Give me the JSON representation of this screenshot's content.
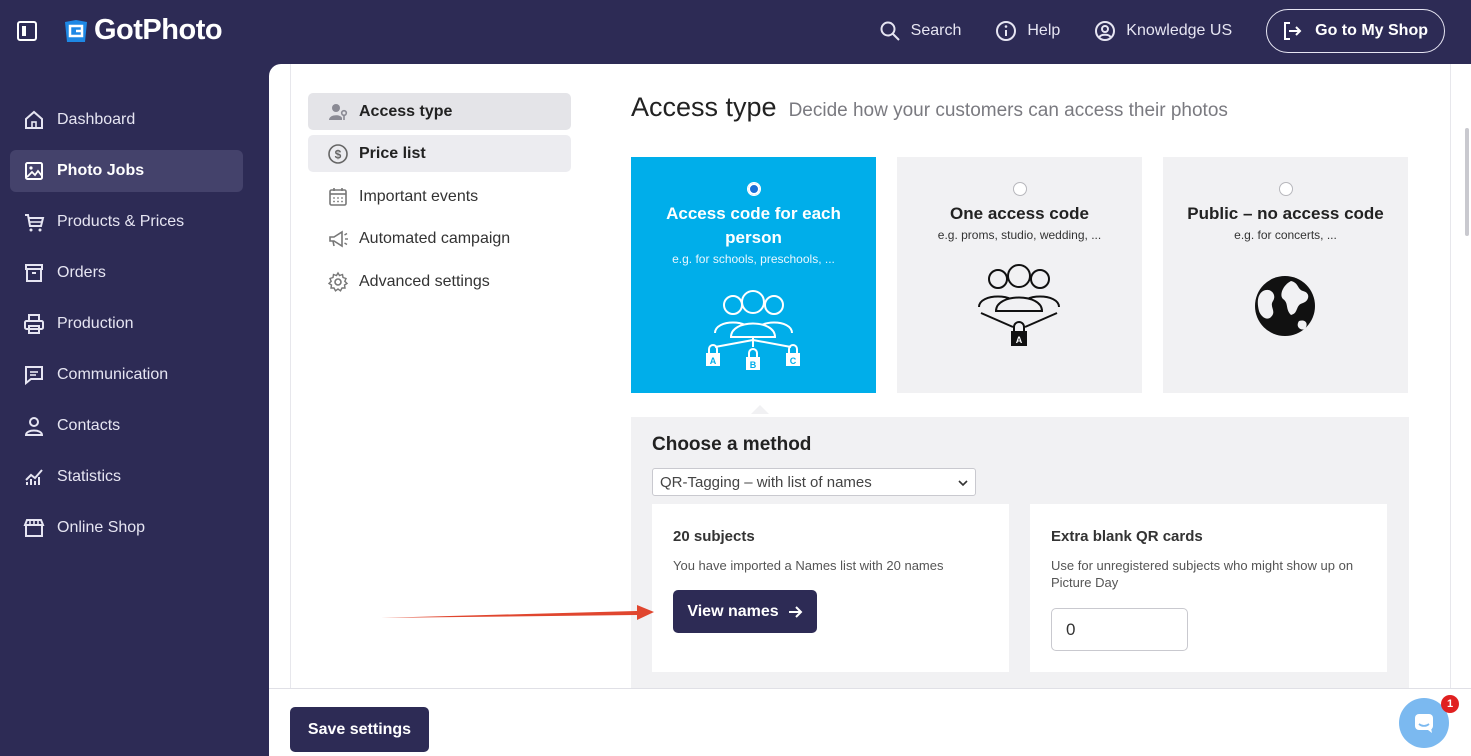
{
  "app": {
    "brand": "GotPhoto"
  },
  "topbar": {
    "search_label": "Search",
    "help_label": "Help",
    "account_label": "Knowledge US",
    "shop_button_label": "Go to My Shop"
  },
  "sidebar": {
    "items": [
      {
        "label": "Dashboard",
        "icon": "home-icon"
      },
      {
        "label": "Photo Jobs",
        "icon": "image-icon",
        "active": true
      },
      {
        "label": "Products & Prices",
        "icon": "cart-icon"
      },
      {
        "label": "Orders",
        "icon": "box-icon"
      },
      {
        "label": "Production",
        "icon": "printer-icon"
      },
      {
        "label": "Communication",
        "icon": "chat-icon"
      },
      {
        "label": "Contacts",
        "icon": "person-icon"
      },
      {
        "label": "Statistics",
        "icon": "chart-icon"
      },
      {
        "label": "Online Shop",
        "icon": "store-icon"
      }
    ]
  },
  "subnav": {
    "items": [
      {
        "label": "Access type",
        "icon": "user-key-icon",
        "selected": true
      },
      {
        "label": "Price list",
        "icon": "dollar-circle-icon",
        "selected": true
      },
      {
        "label": "Important events",
        "icon": "calendar-icon"
      },
      {
        "label": "Automated campaign",
        "icon": "megaphone-icon"
      },
      {
        "label": "Advanced settings",
        "icon": "gear-icon"
      }
    ]
  },
  "page": {
    "title": "Access type",
    "subtitle": "Decide how your customers can access their photos"
  },
  "access_options": [
    {
      "title": "Access code for each person",
      "desc": "e.g. for schools, preschools, ...",
      "selected": true
    },
    {
      "title": "One access code",
      "desc": "e.g. proms, studio, wedding, ...",
      "selected": false
    },
    {
      "title": "Public – no access code",
      "desc": "e.g. for concerts, ...",
      "selected": false
    }
  ],
  "lock_letters": [
    "A",
    "B",
    "C"
  ],
  "method": {
    "title": "Choose a method",
    "selected_option": "QR-Tagging – with list of names",
    "subjects": {
      "title": "20 subjects",
      "text": "You have imported a Names list with 20 names",
      "button": "View names"
    },
    "extra_cards": {
      "title": "Extra blank QR cards",
      "text": "Use for unregistered subjects who might show up on Picture Day",
      "value": "0"
    }
  },
  "footer": {
    "save_label": "Save settings"
  },
  "chat": {
    "badge_count": "1"
  },
  "colors": {
    "navy": "#2d2b55",
    "accent_blue": "#00aeea",
    "annotation_red": "#e0462f"
  }
}
